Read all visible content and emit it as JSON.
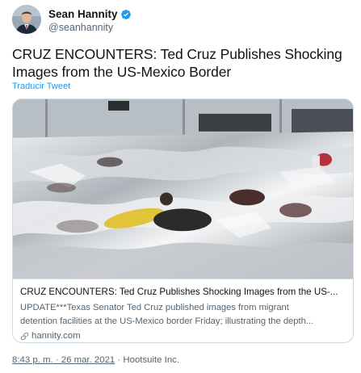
{
  "author": {
    "name": "Sean Hannity",
    "handle": "@seanhannity",
    "verified_color": "#1d9bf0"
  },
  "tweet": {
    "text": "CRUZ ENCOUNTERS: Ted Cruz Publishes Shocking Images from the US-Mexico Border",
    "translate_label": "Traducir Tweet"
  },
  "card": {
    "title": "CRUZ ENCOUNTERS: Ted Cruz Publishes Shocking Images from the US-...",
    "description_line1": "UPDATE***Texas Senator Ted Cruz published images from migrant",
    "description_line2": "detention facilities at the US-Mexico border Friday; illustrating the depth...",
    "domain": "hannity.com",
    "domain_icon": "link-icon"
  },
  "meta": {
    "timestamp": "8:43 p. m. · 26 mar. 2021",
    "separator": " · ",
    "source": "Hootsuite Inc."
  },
  "colors": {
    "accent": "#1d9bf0",
    "text": "#0f1419",
    "secondary": "#536471",
    "border": "#cfd9de"
  }
}
